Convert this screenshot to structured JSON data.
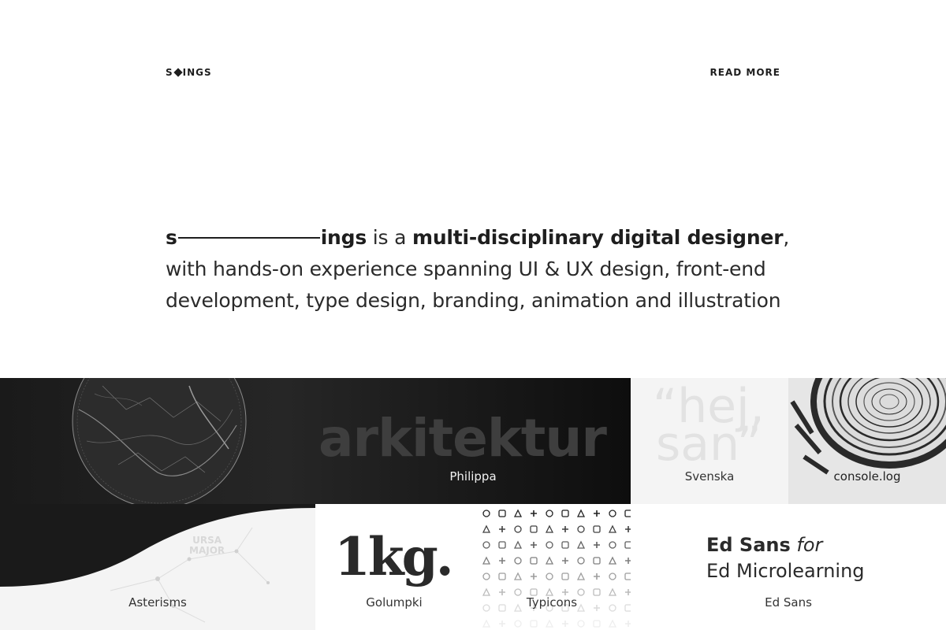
{
  "header": {
    "logo_left": "S",
    "logo_right": "INGS",
    "read_more": "READ MORE"
  },
  "intro": {
    "name_start": "s",
    "name_end": "ings",
    "text_1": " is a ",
    "bold_role": "multi-disciplinary digital designer",
    "text_2": ", with hands-on experience spanning UI & UX design, front-end development, type design, branding, animation and illustration"
  },
  "projects": [
    {
      "label": "Philippa",
      "preview_text": "arkitektur"
    },
    {
      "label": "Svenska",
      "preview_text_1": "“hej,",
      "preview_text_2": "san”"
    },
    {
      "label": "console.log"
    },
    {
      "label": "Asterisms",
      "preview_text_1": "URSA",
      "preview_text_2": "MAJOR"
    },
    {
      "label": "Golumpki",
      "preview_text": "1kg."
    },
    {
      "label": "Typicons"
    },
    {
      "label": "Ed Sans",
      "preview_bold": "Ed Sans",
      "preview_italic": "for",
      "preview_line2": "Ed Microlearning"
    }
  ],
  "colors": {
    "text": "#1e1e1e",
    "dark_tile": "#1a1a1a",
    "light_tile": "#f4f4f4"
  }
}
